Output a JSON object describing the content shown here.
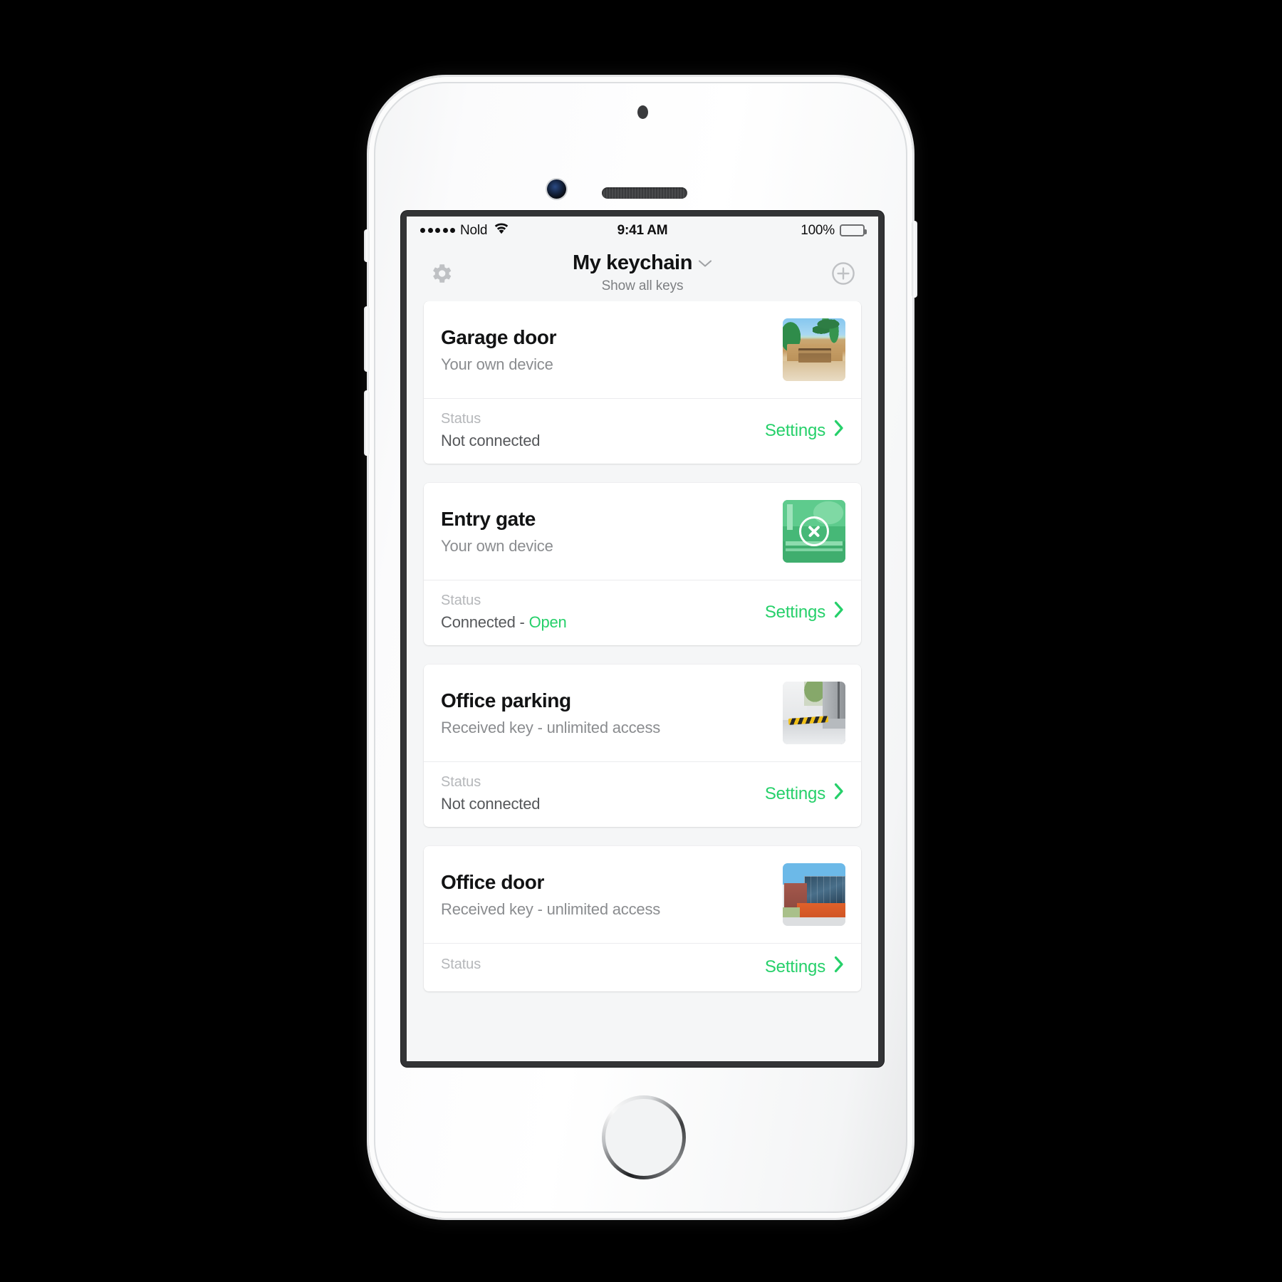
{
  "status_bar": {
    "carrier": "Nold",
    "signal_dots": 5,
    "wifi_icon": "wifi-icon",
    "time": "9:41 AM",
    "battery_percent": "100%",
    "battery_icon": "battery-full-icon"
  },
  "navbar": {
    "settings_icon": "gear-icon",
    "title": "My keychain",
    "title_chevron_icon": "chevron-down-icon",
    "subtitle": "Show all keys",
    "add_icon": "plus-circle-icon"
  },
  "labels": {
    "status": "Status",
    "settings": "Settings",
    "chevron_right_icon": "chevron-right-icon"
  },
  "colors": {
    "accent_green": "#26d06a",
    "page_background": "#f5f6f7",
    "card_background": "#ffffff",
    "title_text": "#121314",
    "muted_text": "#8a8c8f",
    "status_label": "#b5b7ba"
  },
  "cards": [
    {
      "title": "Garage door",
      "subtitle": "Your own device",
      "status_label": "Status",
      "status_value": "Not connected",
      "status_accent": "",
      "settings_label": "Settings",
      "thumbnail": "garage-door-photo",
      "active": false
    },
    {
      "title": "Entry gate",
      "subtitle": "Your own device",
      "status_label": "Status",
      "status_value": "Connected - ",
      "status_accent": "Open",
      "settings_label": "Settings",
      "thumbnail": "entry-gate-photo",
      "active": true,
      "overlay_icon": "close-circle-icon"
    },
    {
      "title": "Office parking",
      "subtitle": "Received key - unlimited access",
      "status_label": "Status",
      "status_value": "Not connected",
      "status_accent": "",
      "settings_label": "Settings",
      "thumbnail": "office-parking-photo",
      "active": false
    },
    {
      "title": "Office door",
      "subtitle": "Received key - unlimited access",
      "status_label": "Status",
      "status_value": "",
      "status_accent": "",
      "settings_label": "Settings",
      "thumbnail": "office-building-photo",
      "active": false
    }
  ]
}
